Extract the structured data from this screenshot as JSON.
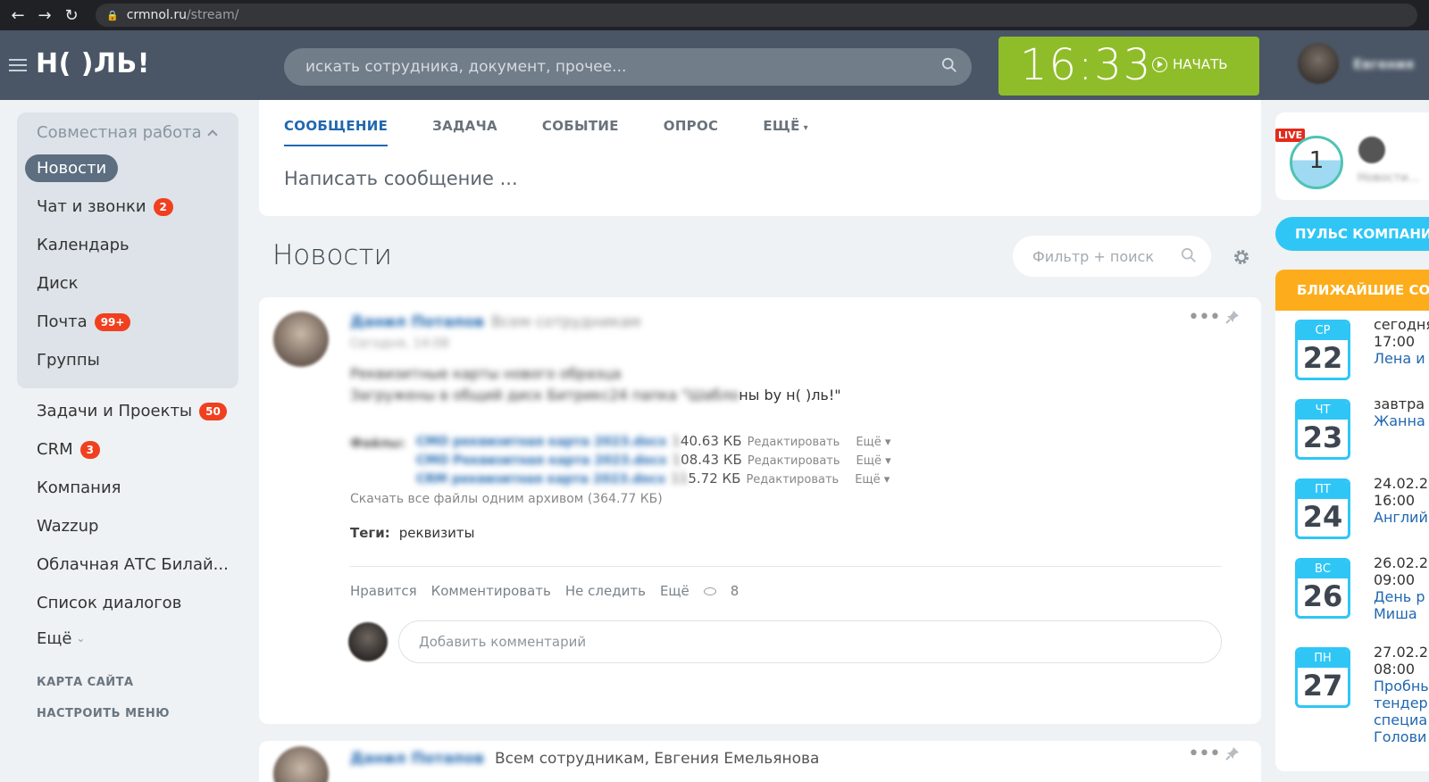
{
  "browser": {
    "back": "←",
    "forward": "→",
    "reload": "↻",
    "url_host": "crmnol.ru",
    "url_path": "/stream/"
  },
  "header": {
    "logo": "Н( )ЛЬ!",
    "search_placeholder": "искать сотрудника, документ, прочее...",
    "time": "16:33",
    "start_label": "НАЧАТЬ",
    "user_name": "Евгения"
  },
  "menu": {
    "group_title": "Совместная работа",
    "group_items": [
      {
        "label": "Новости",
        "badge": ""
      },
      {
        "label": "Чат и звонки",
        "badge": "2"
      },
      {
        "label": "Календарь",
        "badge": ""
      },
      {
        "label": "Диск",
        "badge": ""
      },
      {
        "label": "Почта",
        "badge": "99+"
      },
      {
        "label": "Группы",
        "badge": ""
      }
    ],
    "items": [
      {
        "label": "Задачи и Проекты",
        "badge": "50"
      },
      {
        "label": "CRM",
        "badge": "3"
      },
      {
        "label": "Компания",
        "badge": ""
      },
      {
        "label": "Wazzup",
        "badge": ""
      },
      {
        "label": "Облачная АТС Билай...",
        "badge": ""
      },
      {
        "label": "Список диалогов",
        "badge": ""
      },
      {
        "label": "Ещё",
        "badge": ""
      }
    ],
    "sitemap": "КАРТА САЙТА",
    "configure": "НАСТРОИТЬ МЕНЮ"
  },
  "composer": {
    "tabs": [
      "СООБЩЕНИЕ",
      "ЗАДАЧА",
      "СОБЫТИЕ",
      "ОПРОС",
      "ЕЩЁ"
    ],
    "placeholder": "Написать сообщение ..."
  },
  "news": {
    "title": "Новости",
    "filter_placeholder": "Фильтр + поиск"
  },
  "post": {
    "author": "Данил Потапов",
    "destination": "Всем сотрудникам",
    "date": "Сегодня, 14:08",
    "line1": "Реквизитные карты нового образца",
    "line2_blur": "Загружены в общий диск Битрикс24 папка \"Шабло",
    "line2_clear": "ны by н( )ль!\"",
    "files_label": "Файлы:",
    "files": [
      {
        "name": "CMO реквизитная карта 2023.docx",
        "size_hidden": "1",
        "size": "40.63 КБ",
        "edit": "Редактировать",
        "more": "Ещё"
      },
      {
        "name": "CMO Реквизитная карта 2023.docx",
        "size_hidden": "1",
        "size": "08.43 КБ",
        "edit": "Редактировать",
        "more": "Ещё"
      },
      {
        "name": "CRM реквизитная карта 2023.docx",
        "size_hidden": "11",
        "size": "5.72 КБ",
        "edit": "Редактировать",
        "more": "Ещё"
      }
    ],
    "download_all": "Скачать все файлы одним архивом (364.77 КБ)",
    "tags_label": "Теги:",
    "tags_value": "реквизиты",
    "actions": [
      "Нравится",
      "Комментировать",
      "Не следить",
      "Ещё"
    ],
    "views": "8",
    "comment_placeholder": "Добавить комментарий"
  },
  "post2": {
    "author": "Данил Потапов",
    "destination": "Всем сотрудникам, Евгения Емельянова"
  },
  "right": {
    "live_label": "LIVE",
    "live_count": "1",
    "live_text": "Новости...",
    "pulse": "ПУЛЬС КОМПАНИИ",
    "events_title": "БЛИЖАЙШИЕ СОБЫТИЯ",
    "events": [
      {
        "dow": "СР",
        "day": "22",
        "line1": "сегодня",
        "line2": "17:00",
        "name": "Лена и"
      },
      {
        "dow": "ЧТ",
        "day": "23",
        "line1": "завтра",
        "line2": "",
        "name": "Жанна"
      },
      {
        "dow": "ПТ",
        "day": "24",
        "line1": "24.02.2",
        "line2": "16:00",
        "name": "Англий"
      },
      {
        "dow": "ВС",
        "day": "26",
        "line1": "26.02.2",
        "line2": "09:00",
        "name": "День р",
        "name2": "Миша"
      },
      {
        "dow": "ПН",
        "day": "27",
        "line1": "27.02.2",
        "line2": "08:00",
        "name": "Пробны",
        "name2": "тендер",
        "name3": "специа",
        "name4": "Голови"
      }
    ]
  }
}
